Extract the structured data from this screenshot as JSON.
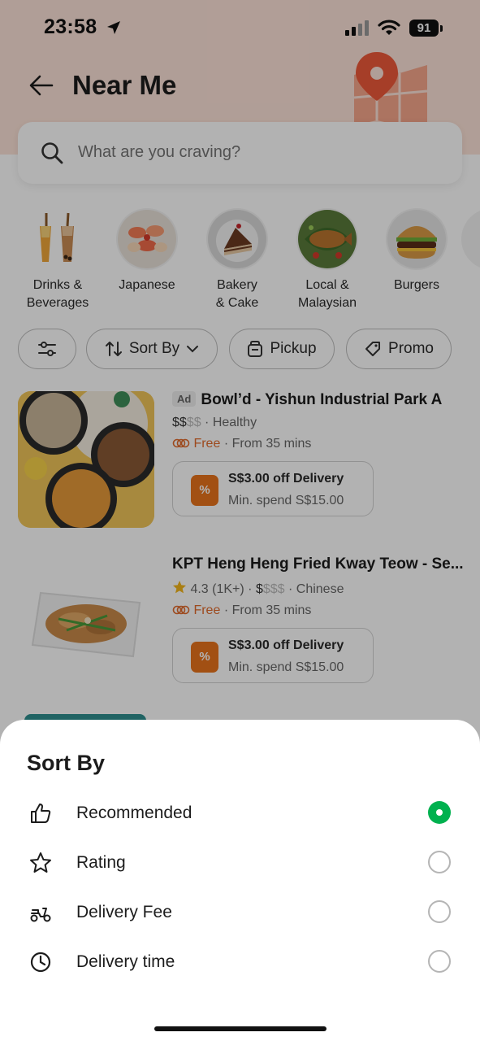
{
  "status_bar": {
    "time": "23:58",
    "battery": "91"
  },
  "header": {
    "title": "Near Me",
    "back_icon": "arrow-left-icon"
  },
  "search": {
    "placeholder": "What are you craving?"
  },
  "categories": [
    {
      "label_line1": "Drinks &",
      "label_line2": "Beverages"
    },
    {
      "label_line1": "Japanese",
      "label_line2": ""
    },
    {
      "label_line1": "Bakery",
      "label_line2": "& Cake"
    },
    {
      "label_line1": "Local &",
      "label_line2": "Malaysian"
    },
    {
      "label_line1": "Burgers",
      "label_line2": ""
    }
  ],
  "filters": {
    "sort_label": "Sort By",
    "pickup_label": "Pickup",
    "promo_label": "Promo"
  },
  "restaurants": [
    {
      "ad": "Ad",
      "name": "Bowl’d - Yishun Industrial Park A",
      "rating": "",
      "price_on": "$$",
      "price_off": "$$",
      "cuisine": "· Healthy",
      "delivery": "Free",
      "time": "· From 35 mins",
      "promo_title": "S$3.00 off Delivery",
      "promo_sub": "Min. spend S$15.00"
    },
    {
      "ad": "",
      "name": "KPT Heng Heng Fried Kway Teow - Se...",
      "rating": "4.3 (1K+) ·",
      "price_on": "$",
      "price_off": "$$$",
      "cuisine": "· Chinese",
      "delivery": "Free",
      "time": "· From 35 mins",
      "promo_title": "S$3.00 off Delivery",
      "promo_sub": "Min. spend S$15.00"
    }
  ],
  "sort_sheet": {
    "title": "Sort By",
    "options": [
      {
        "label": "Recommended",
        "icon": "thumbs-up-icon",
        "selected": true
      },
      {
        "label": "Rating",
        "icon": "star-icon",
        "selected": false
      },
      {
        "label": "Delivery Fee",
        "icon": "scooter-icon",
        "selected": false
      },
      {
        "label": "Delivery time",
        "icon": "clock-icon",
        "selected": false
      }
    ]
  },
  "colors": {
    "accent": "#00b14f",
    "header_bg": "#fde3d8",
    "free": "#e16a2c",
    "promo_tag": "#e8731c"
  }
}
